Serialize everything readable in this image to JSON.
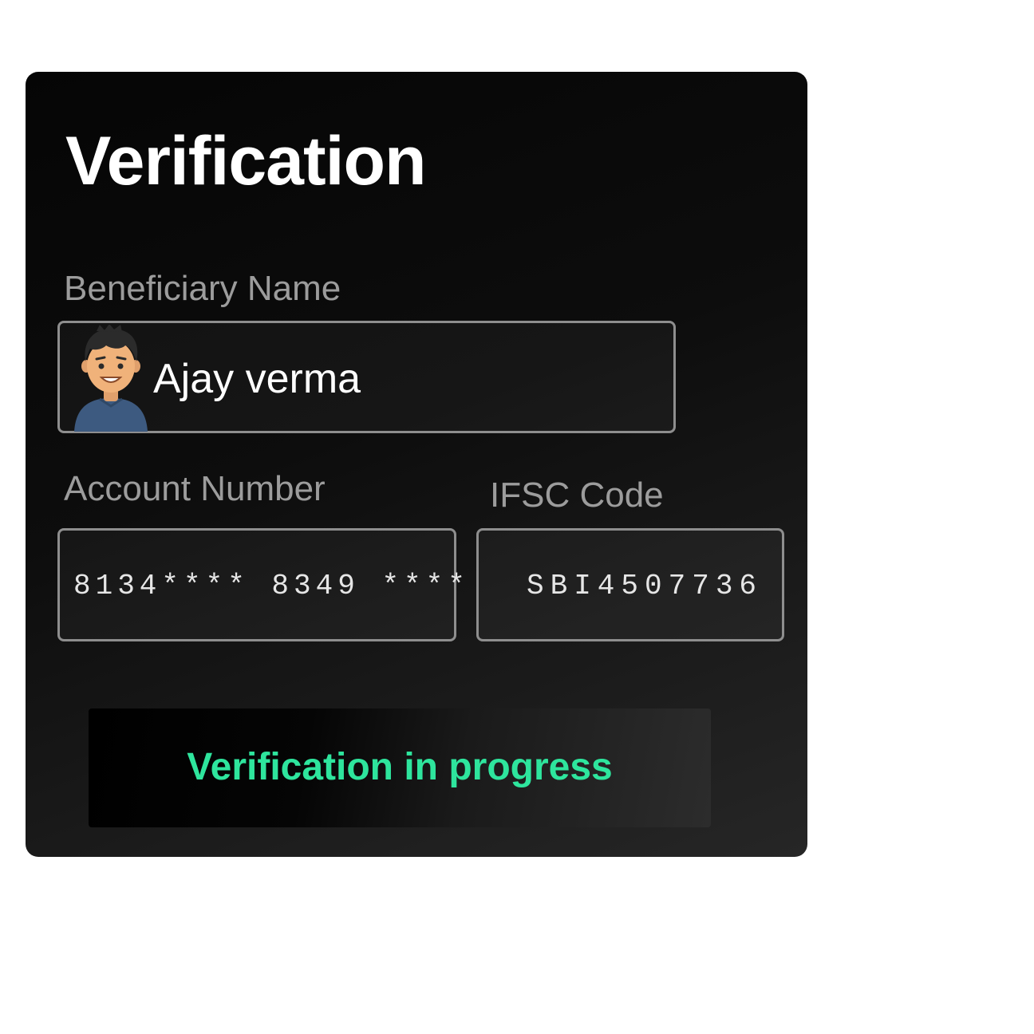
{
  "card": {
    "title": "Verification"
  },
  "beneficiary": {
    "label": "Beneficiary Name",
    "value": "Ajay verma",
    "avatar_icon": "person-avatar-icon"
  },
  "account": {
    "label": "Account Number",
    "value": "8134**** 8349 ****"
  },
  "ifsc": {
    "label": "IFSC Code",
    "value": "SBI4507736"
  },
  "status": {
    "text": "Verification in progress",
    "color": "#2ee59d"
  },
  "colors": {
    "card_background": "#0a0a0a",
    "field_border": "#8e8e8e",
    "label_text": "#9c9c9c",
    "value_text": "#ffffff"
  }
}
